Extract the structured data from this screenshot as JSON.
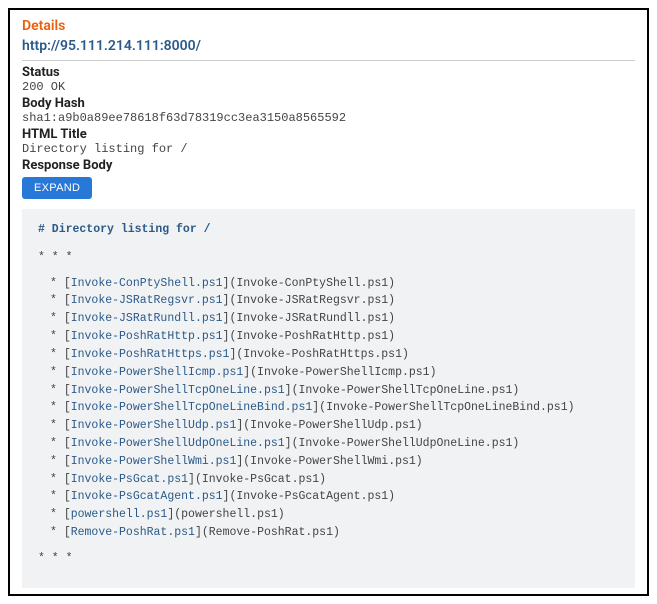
{
  "title": "Details",
  "url": "http://95.111.214.111:8000/",
  "status": {
    "label": "Status",
    "value": "200 OK"
  },
  "body_hash": {
    "label": "Body Hash",
    "value": "sha1:a9b0a89ee78618f63d78319cc3ea3150a8565592"
  },
  "html_title": {
    "label": "HTML Title",
    "value": "Directory listing for /"
  },
  "response_body": {
    "label": "Response Body",
    "expand_label": "EXPAND"
  },
  "body_heading": "# Directory listing for /",
  "stars": "* * *",
  "files": [
    "Invoke-ConPtyShell.ps1",
    "Invoke-JSRatRegsvr.ps1",
    "Invoke-JSRatRundll.ps1",
    "Invoke-PoshRatHttp.ps1",
    "Invoke-PoshRatHttps.ps1",
    "Invoke-PowerShellIcmp.ps1",
    "Invoke-PowerShellTcpOneLine.ps1",
    "Invoke-PowerShellTcpOneLineBind.ps1",
    "Invoke-PowerShellUdp.ps1",
    "Invoke-PowerShellUdpOneLine.ps1",
    "Invoke-PowerShellWmi.ps1",
    "Invoke-PsGcat.ps1",
    "Invoke-PsGcatAgent.ps1",
    "powershell.ps1",
    "Remove-PoshRat.ps1"
  ]
}
